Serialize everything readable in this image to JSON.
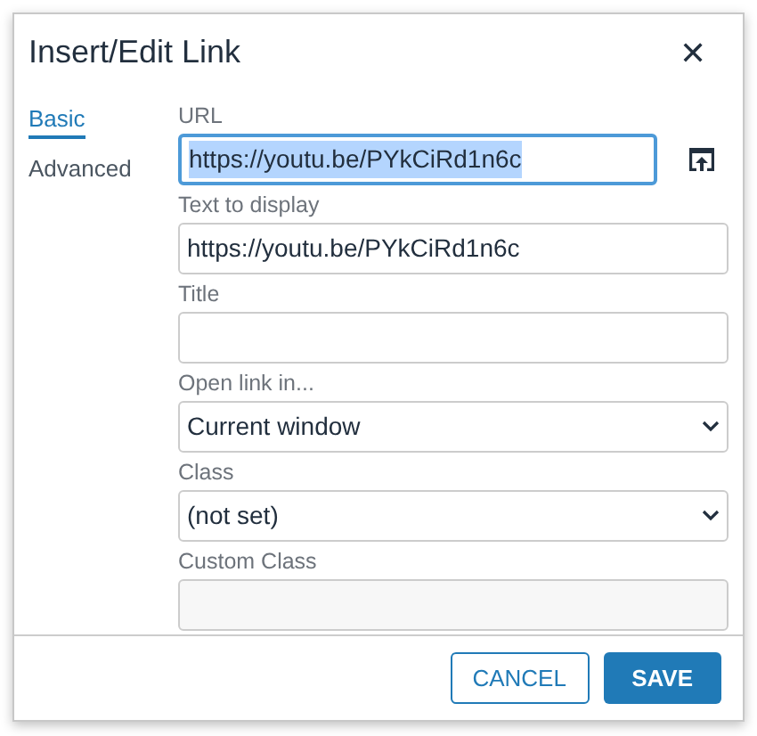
{
  "dialog": {
    "title": "Insert/Edit Link",
    "close": "✕"
  },
  "tabs": [
    {
      "label": "Basic",
      "selected": true
    },
    {
      "label": "Advanced",
      "selected": false
    }
  ],
  "fields": [
    {
      "kind": "url",
      "label": "URL",
      "value": "https://youtu.be/PYkCiRd1n6c",
      "focused": true
    },
    {
      "kind": "text",
      "label": "Text to display",
      "value": "https://youtu.be/PYkCiRd1n6c",
      "focused": false
    },
    {
      "kind": "text",
      "label": "Title",
      "focused": false
    },
    {
      "kind": "select",
      "label": "Open link in...",
      "value": "Current window",
      "focused": false
    },
    {
      "kind": "select",
      "label": "Class",
      "value": "(not set)",
      "focused": false
    },
    {
      "kind": "disabled",
      "label": "Custom Class",
      "focused": false
    }
  ],
  "buttons": [
    {
      "label": "CANCEL",
      "kind": "secondary"
    },
    {
      "label": "SAVE",
      "kind": "primary"
    }
  ]
}
